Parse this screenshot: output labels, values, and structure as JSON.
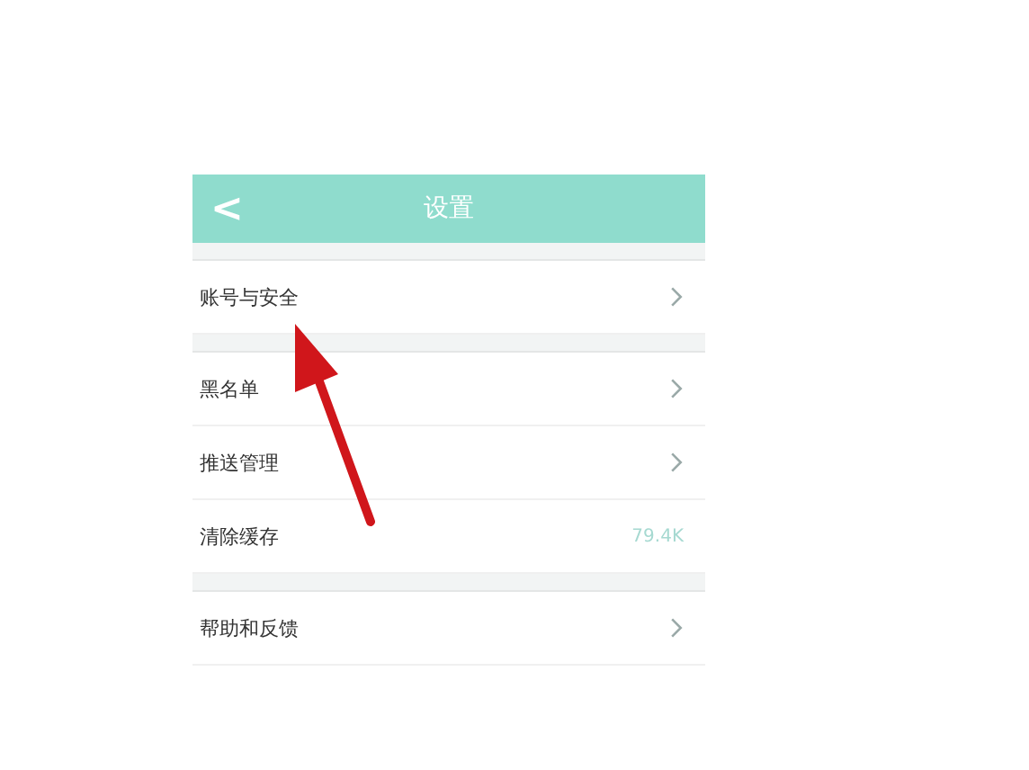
{
  "header": {
    "back": "<",
    "title": "设置"
  },
  "groups": [
    {
      "items": [
        {
          "label": "账号与安全",
          "kind": "link"
        }
      ]
    },
    {
      "items": [
        {
          "label": "黑名单",
          "kind": "link"
        },
        {
          "label": "推送管理",
          "kind": "link"
        },
        {
          "label": "清除缓存",
          "kind": "value",
          "value": "79.4K"
        }
      ]
    },
    {
      "items": [
        {
          "label": "帮助和反馈",
          "kind": "link"
        }
      ]
    }
  ],
  "annotation": {
    "kind": "arrow"
  }
}
